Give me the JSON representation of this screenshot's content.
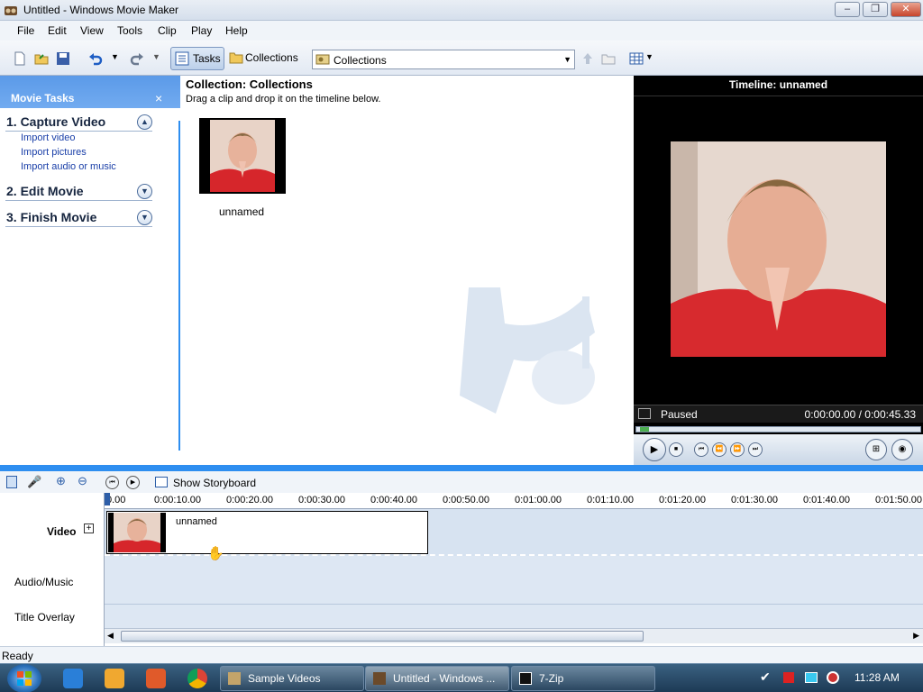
{
  "window": {
    "title": "Untitled - Windows Movie Maker"
  },
  "menu": [
    "File",
    "Edit",
    "View",
    "Tools",
    "Clip",
    "Play",
    "Help"
  ],
  "toolbar": {
    "tasks_label": "Tasks",
    "collections_label": "Collections",
    "collection_select": "Collections"
  },
  "tasks_pane": {
    "title": "Movie Tasks",
    "close": "×",
    "sections": [
      {
        "label": "1. Capture Video",
        "links": [
          "Import video",
          "Import pictures",
          "Import audio or music"
        ],
        "expanded": true
      },
      {
        "label": "2. Edit Movie",
        "links": [],
        "expanded": false
      },
      {
        "label": "3. Finish Movie",
        "links": [],
        "expanded": false
      }
    ]
  },
  "collection": {
    "title": "Collection: Collections",
    "hint": "Drag a clip and drop it on the timeline below.",
    "clip_name": "unnamed"
  },
  "monitor": {
    "title": "Timeline: unnamed",
    "status": "Paused",
    "time": "0:00:00.00 / 0:00:45.33"
  },
  "timeline": {
    "show_storyboard": "Show Storyboard",
    "ticks": [
      "0.00",
      "0:00:10.00",
      "0:00:20.00",
      "0:00:30.00",
      "0:00:40.00",
      "0:00:50.00",
      "0:01:00.00",
      "0:01:10.00",
      "0:01:20.00",
      "0:01:30.00",
      "0:01:40.00",
      "0:01:50.00"
    ],
    "track_labels": {
      "video": "Video",
      "audio": "Audio/Music",
      "title": "Title Overlay"
    },
    "clip_name": "unnamed"
  },
  "status": {
    "text": "Ready"
  },
  "taskbar": {
    "items": [
      "Sample Videos",
      "Untitled - Windows ...",
      "7-Zip"
    ],
    "clock": "11:28 AM"
  },
  "colors": {
    "accent": "#2e8ef0",
    "task_header": "#5b9ae8"
  }
}
